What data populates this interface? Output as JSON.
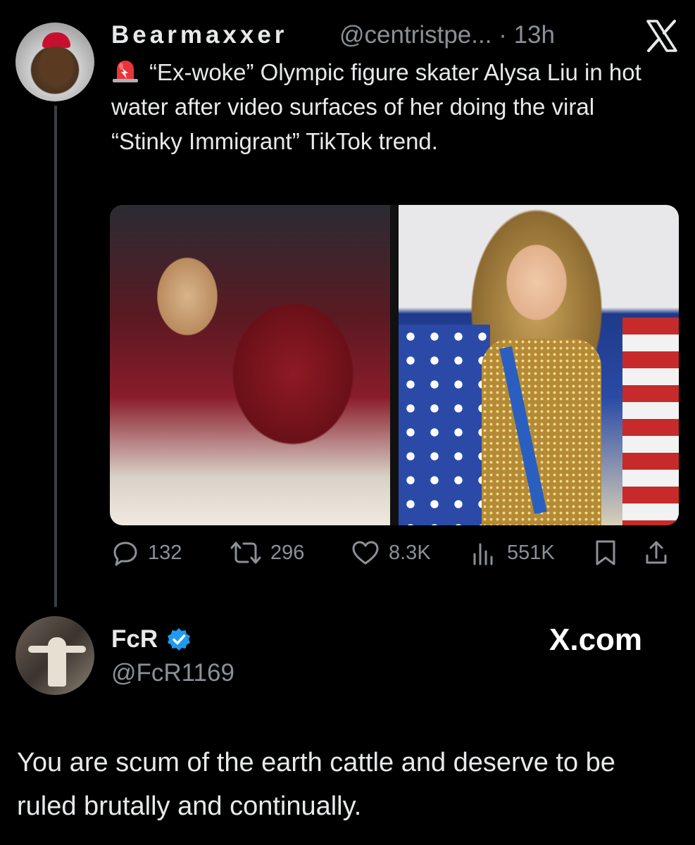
{
  "tweet": {
    "author_name": "Bearmaxxer",
    "author_handle": "@centristpe...",
    "time": "· 13h",
    "emoji": "siren-emoji",
    "text": "“Ex-woke” Olympic figure skater Alysa Liu in hot water after video surfaces of her doing the viral “Stinky Immigrant” TikTok trend.",
    "stats": {
      "replies": "132",
      "reposts": "296",
      "likes": "8.3K",
      "views": "551K"
    }
  },
  "reply": {
    "author_name": "FcR",
    "author_handle": "@FcR1169",
    "text": "You are scum of the earth cattle and deserve to be ruled brutally and continually."
  },
  "watermark": "X.com",
  "colors": {
    "background": "#000000",
    "text_primary": "#e7e9ea",
    "text_secondary": "#8b9096",
    "verified_badge": "#1d9bf0",
    "thread_line": "#3a3d41"
  }
}
